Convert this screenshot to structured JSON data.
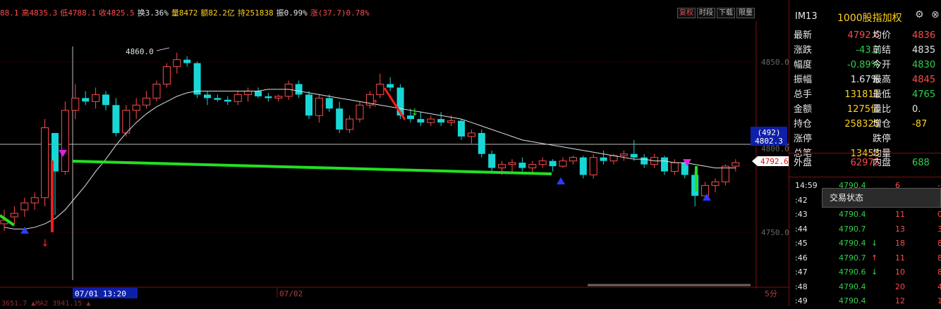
{
  "info": {
    "open_tail": "88.1",
    "high": "高4835.3",
    "low": "低4788.1",
    "close": "收4825.5",
    "turnover": "换3.36%",
    "volume": "量8472",
    "amount": "额82.2亿",
    "hold": "持251838",
    "amplitude": "振0.99%",
    "change": "涨(37.7)0.78%"
  },
  "buttons": [
    "复权",
    "时段",
    "下载",
    "限量"
  ],
  "price_labels": {
    "p4850": "4850.0",
    "p4800": "4800.0",
    "p4750": "4750.0",
    "peak": "4860.0",
    "cursor_top": "(492)",
    "cursor_price": "4802.3",
    "last": "4792.6"
  },
  "time_labels": {
    "cursor_time": "07/01 13:20",
    "day2": "07/02",
    "period": "5分"
  },
  "bottom_text": "3651.7 ▲MA2 3941.15 ▲",
  "panel": {
    "code": "IM13",
    "name": "1000股指加权",
    "rows": [
      {
        "l1": "最新",
        "v1": "4792.6",
        "c1": "#ff4b4b",
        "l2": "均价",
        "v2": "4836",
        "c2": "#ff4b4b"
      },
      {
        "l1": "涨跌",
        "v1": "-43.2",
        "c1": "#2fd24a",
        "l2": "前结",
        "v2": "4835",
        "c2": "#e6e6e6"
      },
      {
        "l1": "幅度",
        "v1": "-0.89%",
        "c1": "#2fd24a",
        "l2": "今开",
        "v2": "4830",
        "c2": "#2fd24a"
      },
      {
        "l1": "振幅",
        "v1": "1.67%",
        "c1": "#e6e6e6",
        "l2": "最高",
        "v2": "4845",
        "c2": "#ff4b4b"
      },
      {
        "l1": "总手",
        "v1": "131811",
        "c1": "#ffd21e",
        "l2": "最低",
        "v2": "4765",
        "c2": "#2fd24a"
      },
      {
        "l1": "金额",
        "v1": "1275亿",
        "c1": "#ffd21e",
        "l2": "量比",
        "v2": "0.",
        "c2": "#e6e6e6"
      },
      {
        "l1": "持仓",
        "v1": "258325",
        "c1": "#ffd21e",
        "l2": "增仓",
        "v2": "-87",
        "c2": "#ffd21e"
      },
      {
        "l1": "涨停",
        "v1": "",
        "c1": "#e6e6e6",
        "l2": "跌停",
        "v2": "",
        "c2": "#e6e6e6"
      },
      {
        "l1": "总笔",
        "v1": "13453",
        "c1": "#ffd21e",
        "l2": "均量",
        "v2": "",
        "c2": "#e6e6e6"
      }
    ],
    "outer": {
      "label": "外盘",
      "value": "62975",
      "label2": "内盘",
      "value2": "688"
    },
    "ticks": [
      {
        "t": "14:59",
        "p": "4790.4",
        "arrow": "",
        "v": "6",
        "n": "-1"
      },
      {
        "t": ":42",
        "p": "",
        "arrow": "",
        "v": "",
        "n": ""
      },
      {
        "t": ":43",
        "p": "4790.4",
        "arrow": "",
        "v": "11",
        "n": "0"
      },
      {
        "t": ":44",
        "p": "4790.7",
        "arrow": "",
        "v": "13",
        "n": "3"
      },
      {
        "t": ":45",
        "p": "4790.4",
        "arrow": "↓",
        "v": "18",
        "n": "8"
      },
      {
        "t": ":46",
        "p": "4790.7",
        "arrow": "↑",
        "v": "11",
        "n": "8"
      },
      {
        "t": ":47",
        "p": "4790.6",
        "arrow": "↓",
        "v": "10",
        "n": "8"
      },
      {
        "t": ":48",
        "p": "4790.4",
        "arrow": "",
        "v": "20",
        "n": "4"
      },
      {
        "t": ":49",
        "p": "4790.4",
        "arrow": "",
        "v": "12",
        "n": "1"
      }
    ],
    "popup": "交易状态"
  },
  "chart_data": {
    "type": "candlestick",
    "ylim": [
      4735,
      4868
    ],
    "candles": [
      [
        4760,
        4768,
        4756,
        4762
      ],
      [
        4764,
        4770,
        4760,
        4766
      ],
      [
        4768,
        4775,
        4764,
        4772
      ],
      [
        4772,
        4778,
        4768,
        4775
      ],
      [
        4775,
        4820,
        4770,
        4815
      ],
      [
        4812,
        4805,
        4765,
        4790
      ],
      [
        4790,
        4830,
        4788,
        4825
      ],
      [
        4825,
        4840,
        4820,
        4832
      ],
      [
        4832,
        4836,
        4828,
        4830
      ],
      [
        4830,
        4838,
        4826,
        4834
      ],
      [
        4834,
        4836,
        4825,
        4828
      ],
      [
        4828,
        4832,
        4810,
        4812
      ],
      [
        4812,
        4828,
        4810,
        4825
      ],
      [
        4825,
        4832,
        4820,
        4828
      ],
      [
        4828,
        4836,
        4826,
        4832
      ],
      [
        4832,
        4842,
        4830,
        4840
      ],
      [
        4840,
        4852,
        4838,
        4850
      ],
      [
        4850,
        4858,
        4846,
        4854
      ],
      [
        4854,
        4856,
        4850,
        4852
      ],
      [
        4852,
        4853,
        4832,
        4834
      ],
      [
        4834,
        4836,
        4828,
        4832
      ],
      [
        4832,
        4834,
        4830,
        4831
      ],
      [
        4831,
        4833,
        4828,
        4830
      ],
      [
        4830,
        4836,
        4828,
        4834
      ],
      [
        4834,
        4838,
        4830,
        4836
      ],
      [
        4836,
        4838,
        4832,
        4833
      ],
      [
        4833,
        4835,
        4830,
        4832
      ],
      [
        4832,
        4834,
        4830,
        4833
      ],
      [
        4833,
        4842,
        4831,
        4840
      ],
      [
        4840,
        4842,
        4832,
        4834
      ],
      [
        4834,
        4836,
        4820,
        4822
      ],
      [
        4822,
        4834,
        4818,
        4832
      ],
      [
        4832,
        4834,
        4824,
        4826
      ],
      [
        4826,
        4830,
        4812,
        4814
      ],
      [
        4814,
        4822,
        4812,
        4820
      ],
      [
        4820,
        4830,
        4818,
        4828
      ],
      [
        4828,
        4836,
        4826,
        4834
      ],
      [
        4834,
        4846,
        4832,
        4840
      ],
      [
        4840,
        4844,
        4836,
        4838
      ],
      [
        4838,
        4840,
        4820,
        4822
      ],
      [
        4822,
        4826,
        4818,
        4820
      ],
      [
        4820,
        4824,
        4816,
        4818
      ],
      [
        4818,
        4822,
        4816,
        4820
      ],
      [
        4820,
        4824,
        4816,
        4818
      ],
      [
        4818,
        4822,
        4816,
        4819
      ],
      [
        4819,
        4820,
        4808,
        4810
      ],
      [
        4810,
        4814,
        4806,
        4812
      ],
      [
        4812,
        4814,
        4798,
        4800
      ],
      [
        4800,
        4802,
        4790,
        4792
      ],
      [
        4792,
        4796,
        4788,
        4794
      ],
      [
        4794,
        4797,
        4790,
        4795
      ],
      [
        4795,
        4798,
        4790,
        4792
      ],
      [
        4792,
        4796,
        4788,
        4794
      ],
      [
        4794,
        4798,
        4792,
        4796
      ],
      [
        4796,
        4797,
        4790,
        4793
      ],
      [
        4793,
        4798,
        4792,
        4796
      ],
      [
        4796,
        4799,
        4794,
        4798
      ],
      [
        4798,
        4799,
        4786,
        4788
      ],
      [
        4788,
        4800,
        4786,
        4798
      ],
      [
        4798,
        4802,
        4794,
        4796
      ],
      [
        4796,
        4800,
        4794,
        4799
      ],
      [
        4799,
        4802,
        4796,
        4800
      ],
      [
        4800,
        4808,
        4796,
        4798
      ],
      [
        4798,
        4800,
        4792,
        4794
      ],
      [
        4794,
        4800,
        4792,
        4798
      ],
      [
        4798,
        4799,
        4788,
        4790
      ],
      [
        4790,
        4797,
        4788,
        4795
      ],
      [
        4795,
        4796,
        4786,
        4788
      ],
      [
        4788,
        4790,
        4770,
        4776
      ],
      [
        4776,
        4784,
        4774,
        4782
      ],
      [
        4782,
        4786,
        4778,
        4784
      ],
      [
        4784,
        4794,
        4782,
        4793
      ],
      [
        4793,
        4797,
        4790,
        4795
      ]
    ],
    "ma_line": [
      4758,
      4757,
      4757,
      4758,
      4760,
      4763,
      4768,
      4775,
      4782,
      4790,
      4797,
      4805,
      4812,
      4818,
      4823,
      4827,
      4830,
      4833,
      4835,
      4836,
      4836,
      4836,
      4836,
      4836,
      4836,
      4836,
      4837,
      4837,
      4837,
      4836,
      4835,
      4834,
      4833,
      4832,
      4831,
      4830,
      4829,
      4828,
      4827,
      4826,
      4825,
      4824,
      4823,
      4822,
      4821,
      4820,
      4818,
      4816,
      4814,
      4812,
      4810,
      4808,
      4807,
      4806,
      4805,
      4804,
      4803,
      4802,
      4801,
      4800,
      4799,
      4798,
      4797,
      4797,
      4796,
      4796,
      4795,
      4795,
      4794,
      4793,
      4792,
      4792,
      4792
    ]
  }
}
